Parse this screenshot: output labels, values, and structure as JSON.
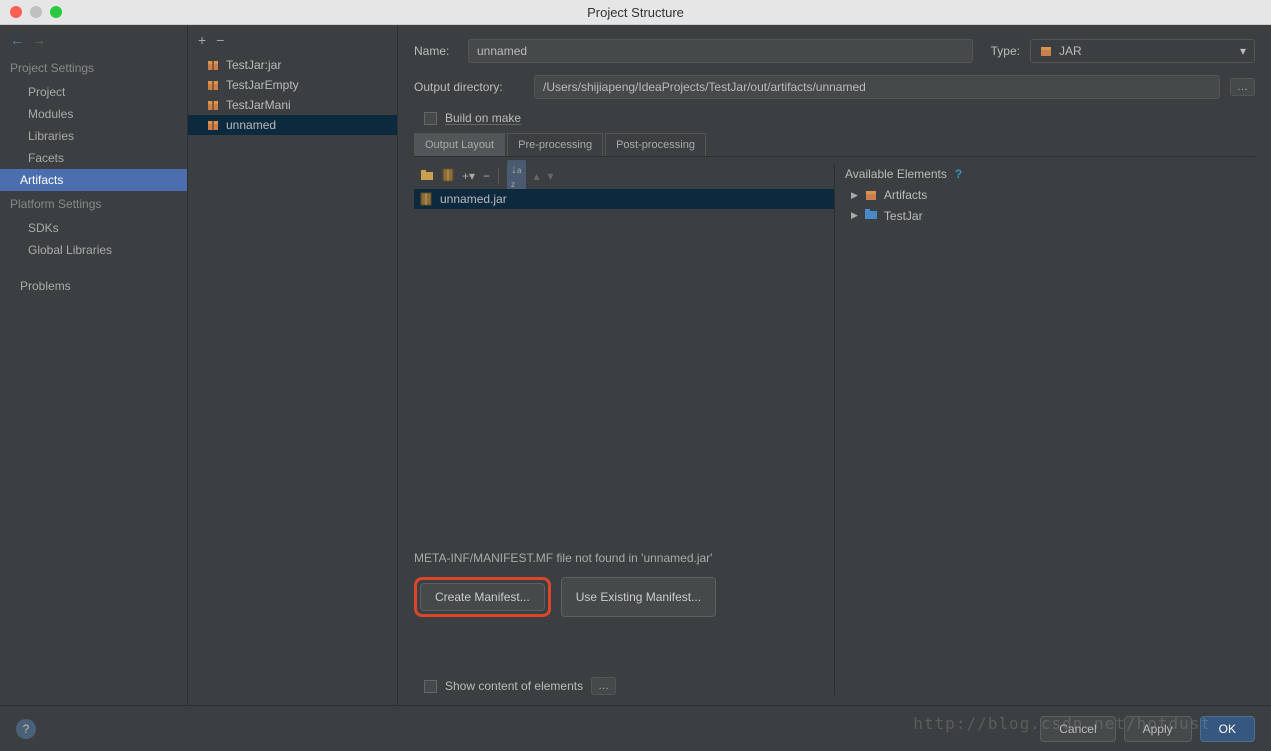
{
  "window": {
    "title": "Project Structure"
  },
  "sidebar": {
    "project_settings_label": "Project Settings",
    "platform_settings_label": "Platform Settings",
    "items": {
      "project": "Project",
      "modules": "Modules",
      "libraries": "Libraries",
      "facets": "Facets",
      "artifacts": "Artifacts",
      "sdks": "SDKs",
      "global_libraries": "Global Libraries",
      "problems": "Problems"
    }
  },
  "tree": {
    "items": [
      {
        "label": "TestJar:jar"
      },
      {
        "label": "TestJarEmpty"
      },
      {
        "label": "TestJarMani"
      },
      {
        "label": "unnamed"
      }
    ]
  },
  "form": {
    "name_label": "Name:",
    "name_value": "unnamed",
    "type_label": "Type:",
    "type_value": "JAR",
    "output_label": "Output directory:",
    "output_value": "/Users/shijiapeng/IdeaProjects/TestJar/out/artifacts/unnamed",
    "build_on_make": "Build on make"
  },
  "tabs": {
    "output_layout": "Output Layout",
    "pre_processing": "Pre-processing",
    "post_processing": "Post-processing"
  },
  "layout": {
    "jar_name": "unnamed.jar",
    "available_elements": "Available Elements",
    "ae_items": [
      {
        "label": "Artifacts"
      },
      {
        "label": "TestJar"
      }
    ]
  },
  "manifest": {
    "message": "META-INF/MANIFEST.MF file not found in 'unnamed.jar'",
    "create_btn": "Create Manifest...",
    "use_existing_btn": "Use Existing Manifest..."
  },
  "bottom": {
    "show_content": "Show content of elements"
  },
  "footer": {
    "cancel": "Cancel",
    "apply": "Apply",
    "ok": "OK"
  },
  "watermark": "http://blog.csdn.net/hotdust"
}
